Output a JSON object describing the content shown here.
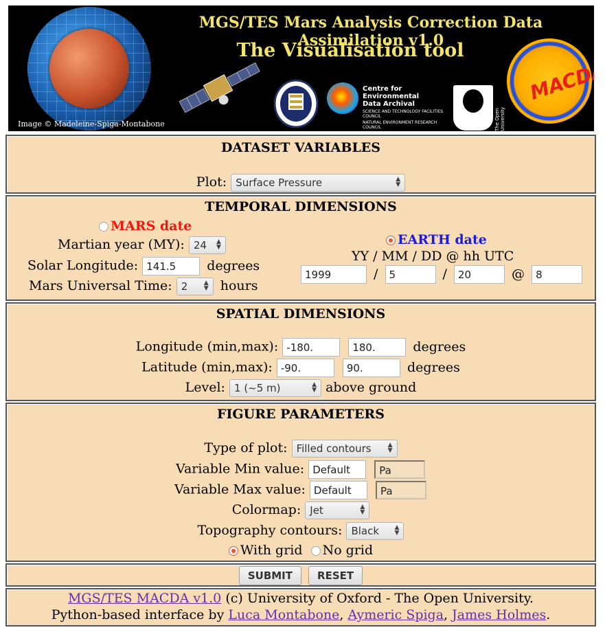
{
  "banner": {
    "title": "MGS/TES Mars Analysis Correction Data Assimilation v1.0",
    "subtitle": "The Visualisation tool",
    "image_credit": "Image © Madeleine-Spiga-Montabone",
    "ceda_line1": "Centre for Environmental",
    "ceda_line2": "Data Archival",
    "ceda_line3": "SCIENCE AND TECHNOLOGY FACILITIES COUNCIL",
    "ceda_line4": "NATURAL ENVIRONMENT RESEARCH COUNCIL",
    "ou_text": "The Open University",
    "macda_logo": "MACDA"
  },
  "dataset": {
    "title": "DATASET VARIABLES",
    "plot_label": "Plot:",
    "plot_value": "Surface Pressure"
  },
  "temporal": {
    "title": "TEMPORAL DIMENSIONS",
    "mars_label": "MARS date",
    "mars_selected": false,
    "martian_year_label": "Martian year (MY):",
    "martian_year_value": "24",
    "ls_label": "Solar Longitude:",
    "ls_value": "141.5",
    "ls_unit": "degrees",
    "mut_label": "Mars Universal Time:",
    "mut_value": "2",
    "mut_unit": "hours",
    "earth_label": "EARTH date",
    "earth_selected": true,
    "earth_format": "YY / MM / DD @ hh UTC",
    "year": "1999",
    "month": "5",
    "day": "20",
    "hour": "8",
    "sep1": "/",
    "sep2": "/",
    "sep3": "@"
  },
  "spatial": {
    "title": "SPATIAL DIMENSIONS",
    "lon_label": "Longitude (min,max):",
    "lon_min": "-180.",
    "lon_max": "180.",
    "lon_unit": "degrees",
    "lat_label": "Latitude (min,max):",
    "lat_min": "-90.",
    "lat_max": "90.",
    "lat_unit": "degrees",
    "level_label": "Level:",
    "level_value": "1 (~5 m)",
    "level_unit": "above ground"
  },
  "figure": {
    "title": "FIGURE PARAMETERS",
    "type_label": "Type of plot:",
    "type_value": "Filled contours",
    "vmin_label": "Variable Min value:",
    "vmin_value": "Default",
    "vmin_unit": "Pa",
    "vmax_label": "Variable Max value:",
    "vmax_value": "Default",
    "vmax_unit": "Pa",
    "cmap_label": "Colormap:",
    "cmap_value": "Jet",
    "topo_label": "Topography contours:",
    "topo_value": "Black",
    "with_grid_label": "With grid",
    "no_grid_label": "No grid",
    "with_grid_selected": true
  },
  "actions": {
    "submit": "SUBMIT",
    "reset": "RESET"
  },
  "footer": {
    "macda_link": "MGS/TES MACDA v1.0",
    "copyright": " (c) University of Oxford - The Open University.",
    "credits_prefix": "Python-based interface by ",
    "author1": "Luca Montabone",
    "author2": "Aymeric Spiga",
    "author3": "James Holmes",
    "comma1": ", ",
    "comma2": ", ",
    "period": "."
  },
  "colors": {
    "panel_bg": "#f7dcb5",
    "banner_title": "#f2e36a",
    "mars_red": "#f0180d",
    "earth_blue": "#1a1ae0",
    "link_purple": "#6a2da8"
  }
}
